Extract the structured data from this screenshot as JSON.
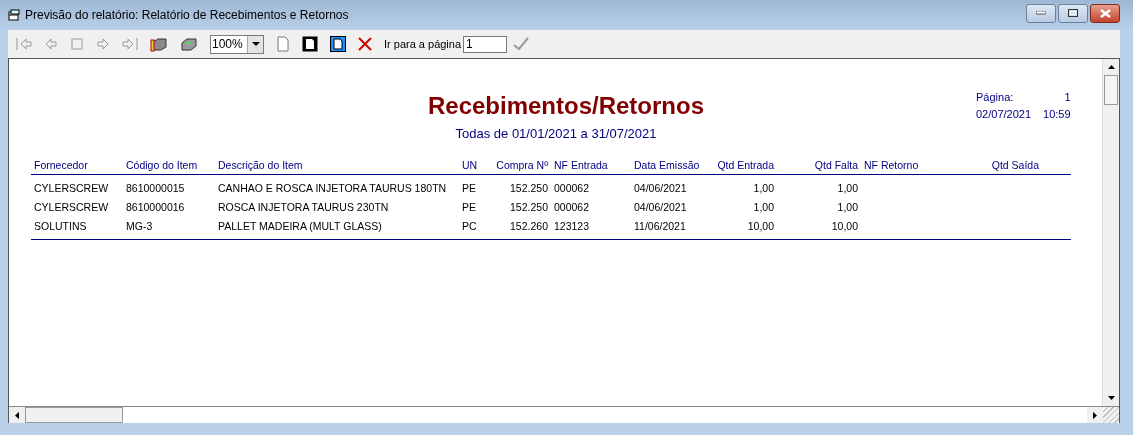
{
  "window": {
    "title": "Previsão do relatório: Relatório de Recebimentos e Retornos"
  },
  "toolbar": {
    "navigation_disabled": true,
    "zoom": "100%",
    "goto_label": "Ir para a página",
    "goto_page": "1"
  },
  "report": {
    "title": "Recebimentos/Retornos",
    "subtitle": "Todas de 01/01/2021 a 31/07/2021",
    "page_label": "Página:",
    "page_number": "1",
    "date": "02/07/2021",
    "time": "10:59",
    "columns": [
      "Fornecedor",
      "Código do Item",
      "Descrição do Item",
      "UN",
      "Compra Nº",
      "NF Entrada",
      "Data Emissão",
      "Qtd Entrada",
      "Qtd Falta",
      "NF Retorno",
      "Qtd Saída"
    ],
    "rows": [
      {
        "cells": [
          "CYLERSCREW",
          "8610000015",
          "CANHAO E ROSCA INJETORA TAURUS 180TN",
          "PE",
          "152.250",
          "000062",
          "04/06/2021",
          "1,00",
          "1,00"
        ]
      },
      {
        "cells": [
          "CYLERSCREW",
          "8610000016",
          "ROSCA INJETORA TAURUS 230TN",
          "PE",
          "152.250",
          "000062",
          "04/06/2021",
          "1,00",
          "1,00"
        ]
      },
      {
        "cells": [
          "SOLUTINS",
          "MG-3",
          "PALLET MADEIRA (MULT GLASS)",
          "PC",
          "152.260",
          "123123",
          "11/06/2021",
          "10,00",
          "10,00"
        ]
      }
    ]
  }
}
